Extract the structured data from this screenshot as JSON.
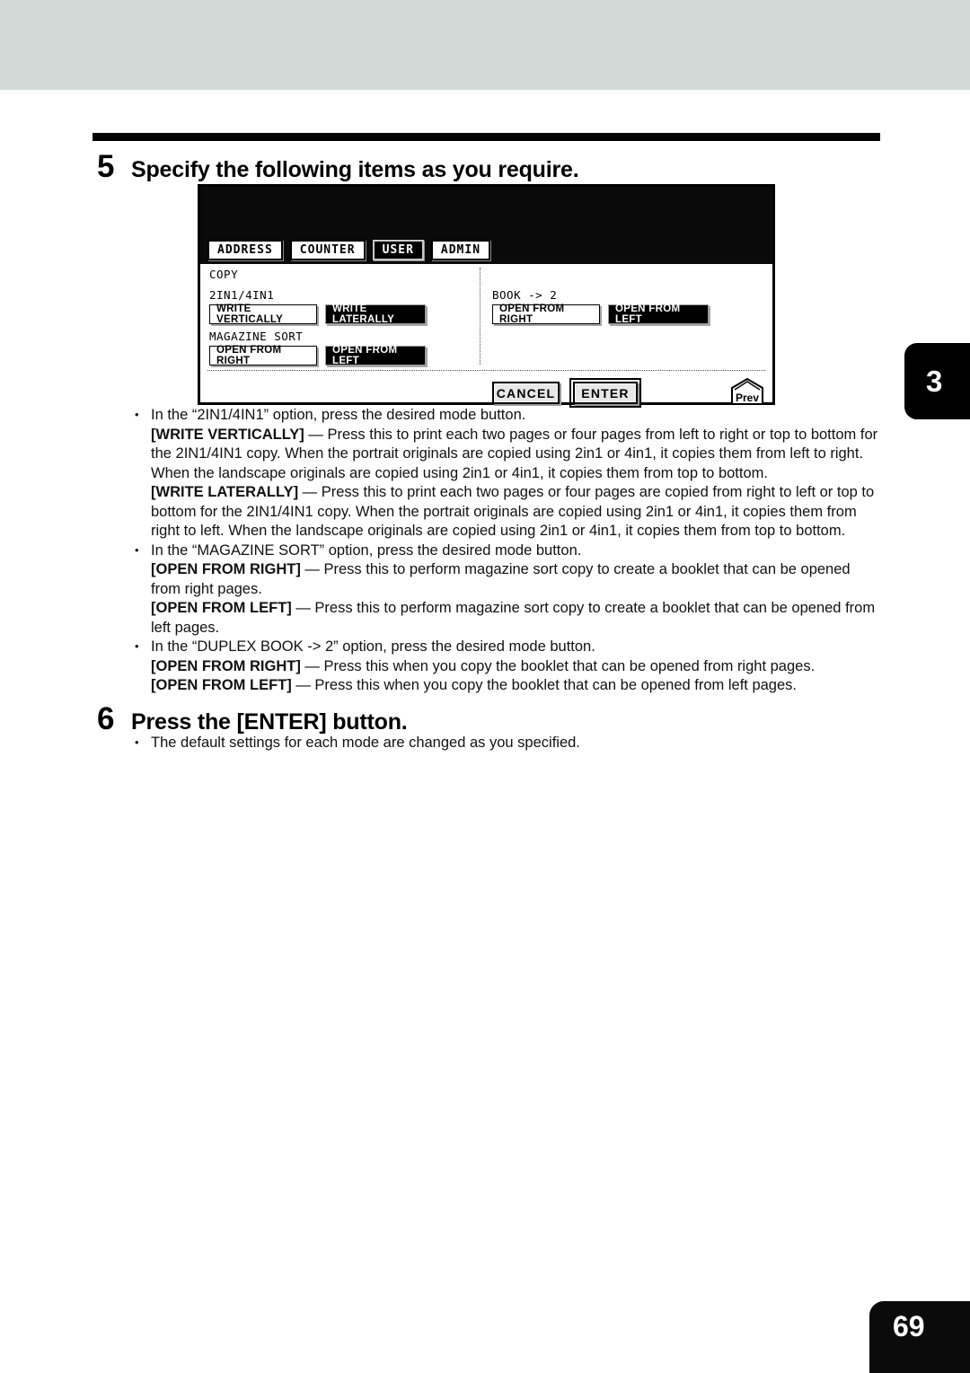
{
  "page": {
    "chapter_tab": "3",
    "page_number": "69"
  },
  "steps": [
    {
      "number": "5",
      "title": "Specify the following items as you require."
    },
    {
      "number": "6",
      "title": "Press the [ENTER] button."
    }
  ],
  "lcd": {
    "tabs": [
      {
        "label": "ADDRESS",
        "selected": false
      },
      {
        "label": "COUNTER",
        "selected": false
      },
      {
        "label": "USER",
        "selected": true
      },
      {
        "label": "ADMIN",
        "selected": false
      }
    ],
    "section_title": "COPY",
    "groups": [
      {
        "label": "2IN1/4IN1",
        "buttons": [
          {
            "label": "WRITE VERTICALLY",
            "selected": false
          },
          {
            "label": "WRITE LATERALLY",
            "selected": true
          }
        ]
      },
      {
        "label": "MAGAZINE SORT",
        "buttons": [
          {
            "label": "OPEN FROM RIGHT",
            "selected": false
          },
          {
            "label": "OPEN FROM LEFT",
            "selected": true
          }
        ]
      },
      {
        "label": "BOOK -> 2",
        "buttons": [
          {
            "label": "OPEN FROM RIGHT",
            "selected": false
          },
          {
            "label": "OPEN FROM LEFT",
            "selected": true
          }
        ]
      }
    ],
    "actions": {
      "cancel": "CANCEL",
      "enter": "ENTER",
      "prev": "Prev"
    }
  },
  "body": {
    "step5": [
      {
        "type": "bullet",
        "text": "In the “2IN1/4IN1” option, press the desired mode button."
      },
      {
        "type": "para",
        "bold": "[WRITE VERTICALLY]",
        "text": " — Press this to print each two pages or four pages from left to right or top to bottom for the 2IN1/4IN1 copy.  When the portrait originals are copied using 2in1 or 4in1, it copies them from left to right.  When the landscape originals are copied using 2in1 or 4in1, it copies them from top to bottom."
      },
      {
        "type": "para",
        "bold": "[WRITE LATERALLY]",
        "text": " — Press this to print each two pages or four pages are copied from right to left or top to bottom for the 2IN1/4IN1 copy.  When the portrait originals are copied using 2in1 or 4in1, it copies them from right to left.  When the landscape originals are copied using 2in1 or 4in1, it copies them from top to bottom."
      },
      {
        "type": "bullet",
        "text": "In the “MAGAZINE SORT” option, press the desired mode button."
      },
      {
        "type": "para",
        "bold": "[OPEN FROM RIGHT]",
        "text": " — Press this to perform magazine sort copy to create a booklet that can be opened from right pages."
      },
      {
        "type": "para",
        "bold": "[OPEN FROM LEFT]",
        "text": " — Press this to perform magazine sort copy to create a booklet that can be opened from left pages."
      },
      {
        "type": "bullet",
        "text": "In the “DUPLEX BOOK -> 2” option, press the desired mode button."
      },
      {
        "type": "para",
        "bold": "[OPEN FROM RIGHT]",
        "text": " — Press this when you copy the booklet that can be opened from right pages."
      },
      {
        "type": "para",
        "bold": "[OPEN FROM LEFT]",
        "text": " — Press this when you copy the booklet that can be opened from left pages."
      }
    ],
    "step6": [
      {
        "type": "bullet",
        "text": "The default settings for each mode are changed as you specified."
      }
    ]
  }
}
